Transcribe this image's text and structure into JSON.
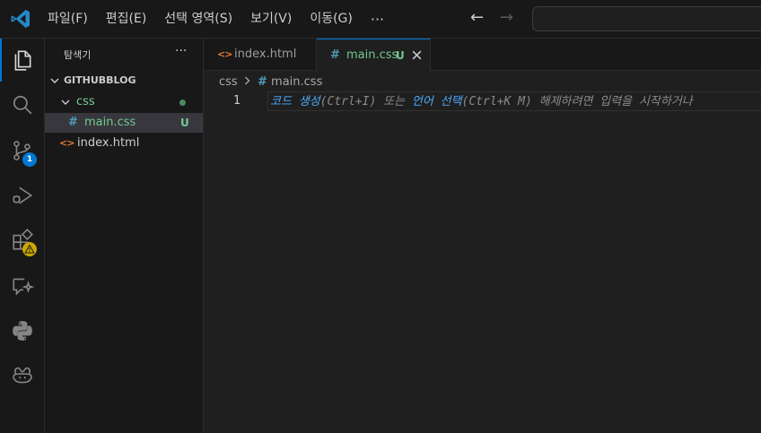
{
  "titlebar": {
    "menu": [
      "파일(F)",
      "편집(E)",
      "선택 영역(S)",
      "보기(V)",
      "이동(G)"
    ],
    "more": "···",
    "back": "←",
    "forward": "→",
    "search_value": ""
  },
  "activitybar": {
    "items": [
      "explorer",
      "search",
      "source-control",
      "run-debug",
      "extensions",
      "chat",
      "python",
      "copilot"
    ],
    "source_control_badge": "1"
  },
  "sidebar": {
    "title": "탐색기",
    "more": "···",
    "folder": "GITHUBBLOG",
    "tree": [
      {
        "name": "css",
        "type": "folder"
      },
      {
        "name": "main.css",
        "type": "file",
        "status": "U"
      },
      {
        "name": "index.html",
        "type": "file"
      }
    ]
  },
  "editor": {
    "tabs": [
      {
        "label": "index.html",
        "active": false
      },
      {
        "label": "main.css",
        "status": "U",
        "active": true
      }
    ],
    "breadcrumb": {
      "folder": "css",
      "file": "main.css"
    },
    "line_number": "1",
    "hint": {
      "part1": "코드 생성",
      "part2": "(Ctrl+I) 또는 ",
      "part3": "언어 선택",
      "part4": "(Ctrl+K M) 해제하려면 입력을 시작하거나"
    }
  },
  "colors": {
    "accent": "#0078d4",
    "css_file": "#519aba",
    "html_file": "#e37933",
    "untracked": "#73c991",
    "warning": "#cca700"
  }
}
